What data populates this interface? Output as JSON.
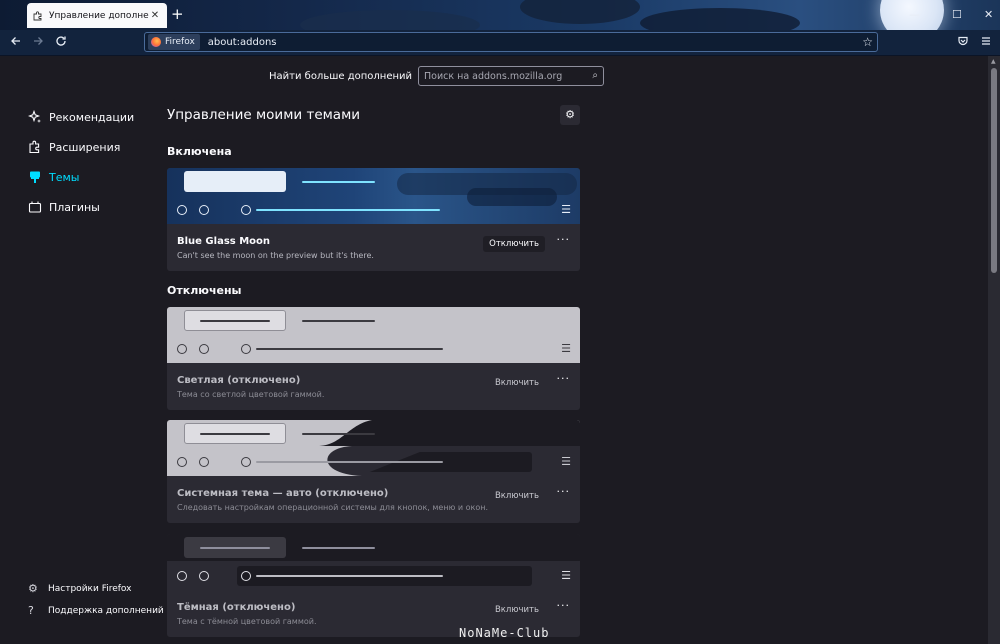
{
  "browser": {
    "tab_title": "Управление дополнениями",
    "identity_label": "Firefox",
    "url": "about:addons",
    "new_tab_glyph": "+",
    "tab_close_glyph": "✕",
    "window_controls": {
      "minimize": "—",
      "maximize": "☐",
      "close": "✕"
    }
  },
  "header": {
    "find_more_label": "Найти больше дополнений",
    "search_placeholder": "Поиск на addons.mozilla.org"
  },
  "sidebar": {
    "items": [
      {
        "label": "Рекомендации",
        "icon": "sparkle-icon"
      },
      {
        "label": "Расширения",
        "icon": "puzzle-icon"
      },
      {
        "label": "Темы",
        "icon": "brush-icon",
        "active": true
      },
      {
        "label": "Плагины",
        "icon": "plugin-icon"
      }
    ],
    "footer": {
      "settings_label": "Настройки Firefox",
      "support_label": "Поддержка дополнений"
    }
  },
  "main": {
    "title": "Управление моими темами",
    "enabled_heading": "Включена",
    "disabled_heading": "Отключены",
    "cards": [
      {
        "name": "Blue Glass Moon",
        "description": "Can't see the moon on the preview but it's there.",
        "action": "Отключить",
        "more": "···"
      },
      {
        "name": "Светлая (отключено)",
        "description": "Тема со светлой цветовой гаммой.",
        "action": "Включить",
        "more": "···"
      },
      {
        "name": "Системная тема — авто (отключено)",
        "description": "Следовать настройкам операционной системы для кнопок, меню и окон.",
        "action": "Включить",
        "more": "···"
      },
      {
        "name": "Тёмная (отключено)",
        "description": "Тема с тёмной цветовой гаммой.",
        "action": "Включить",
        "more": "···"
      }
    ]
  },
  "colors": {
    "accent": "#00ddff",
    "page_bg": "#1c1b22",
    "card_bg": "#2b2a33"
  },
  "watermark": "NoNaMe-Club"
}
